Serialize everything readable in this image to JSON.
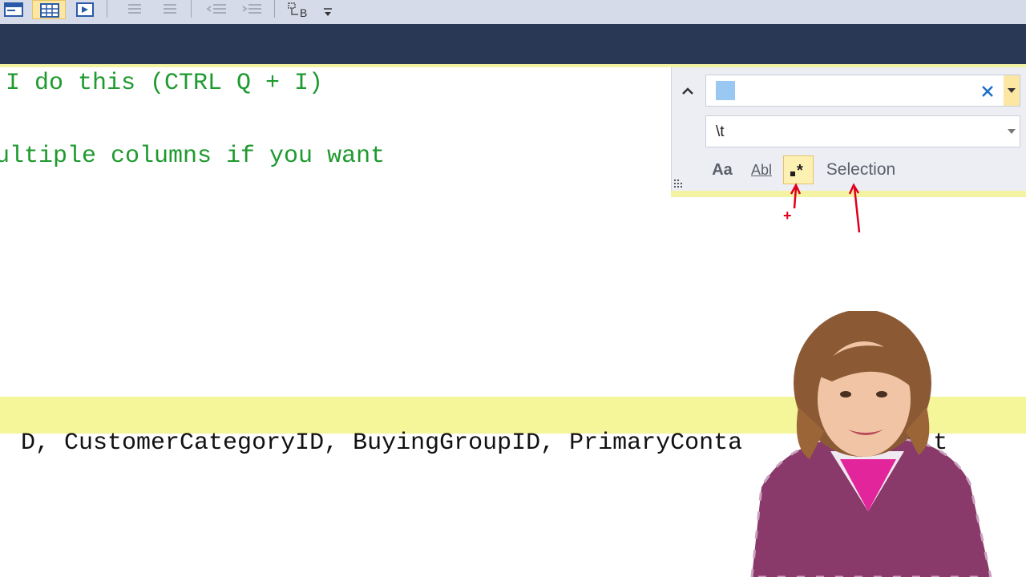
{
  "editor": {
    "line1": "I do this (CTRL Q + I)",
    "line2": "ultiple columns if you want",
    "selected_line": {
      "p1": "D, CustomerCategoryID, BuyingGroupID, PrimaryConta",
      "p2": "ID, Alt"
    }
  },
  "find_panel": {
    "replace_value": "\\t",
    "match_case_label": "Aa",
    "whole_word_label": "Abl",
    "scope_label": "Selection",
    "plus_annotation": "+"
  },
  "colors": {
    "toolbar_bg": "#d6dbe9",
    "title_bar": "#293955",
    "comment_green": "#1e9a2e",
    "selection_yellow": "#f5f59a",
    "annotation_red": "#e0001b"
  },
  "icons": {
    "collapse": "chevron-up-icon",
    "clear": "close-icon",
    "dropdown": "chevron-down-icon",
    "regex": "regex-icon"
  }
}
